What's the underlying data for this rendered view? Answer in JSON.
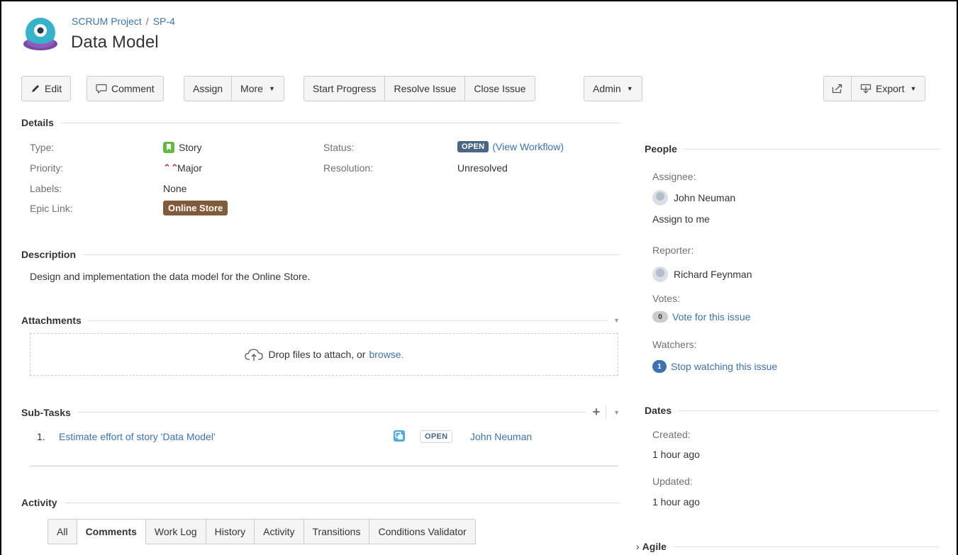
{
  "breadcrumb": {
    "project": "SCRUM Project",
    "separator": "/",
    "issue_key": "SP-4"
  },
  "issue": {
    "title": "Data Model"
  },
  "toolbar": {
    "edit": "Edit",
    "comment": "Comment",
    "assign": "Assign",
    "more": "More",
    "start_progress": "Start Progress",
    "resolve_issue": "Resolve Issue",
    "close_issue": "Close Issue",
    "admin": "Admin",
    "export": "Export"
  },
  "details": {
    "heading": "Details",
    "type_label": "Type:",
    "type_value": "Story",
    "priority_label": "Priority:",
    "priority_value": "Major",
    "labels_label": "Labels:",
    "labels_value": "None",
    "epic_label": "Epic Link:",
    "epic_value": "Online Store",
    "status_label": "Status:",
    "status_value": "OPEN",
    "view_workflow": "(View Workflow)",
    "resolution_label": "Resolution:",
    "resolution_value": "Unresolved"
  },
  "description": {
    "heading": "Description",
    "text": "Design and implementation the data model for the Online Store."
  },
  "attachments": {
    "heading": "Attachments",
    "drop_text": "Drop files to attach, or",
    "browse": "browse."
  },
  "subtasks": {
    "heading": "Sub-Tasks",
    "items": [
      {
        "num": "1.",
        "summary": "Estimate effort of story 'Data Model'",
        "status": "OPEN",
        "assignee": "John Neuman"
      }
    ]
  },
  "activity": {
    "heading": "Activity",
    "tabs": [
      "All",
      "Comments",
      "Work Log",
      "History",
      "Activity",
      "Transitions",
      "Conditions Validator"
    ],
    "active_tab": "Comments"
  },
  "people": {
    "heading": "People",
    "assignee_label": "Assignee:",
    "assignee": "John Neuman",
    "assign_to_me": "Assign to me",
    "reporter_label": "Reporter:",
    "reporter": "Richard Feynman",
    "votes_label": "Votes:",
    "votes_count": "0",
    "vote_link": "Vote for this issue",
    "watchers_label": "Watchers:",
    "watchers_count": "1",
    "watch_link": "Stop watching this issue"
  },
  "dates": {
    "heading": "Dates",
    "created_label": "Created:",
    "created": "1 hour ago",
    "updated_label": "Updated:",
    "updated": "1 hour ago"
  },
  "agile": {
    "heading": "Agile"
  },
  "colors": {
    "link": "#3b73af",
    "status_open": "#4a6785",
    "epic": "#815b3a",
    "story": "#63ba3c",
    "priority_major": "#d04437"
  }
}
